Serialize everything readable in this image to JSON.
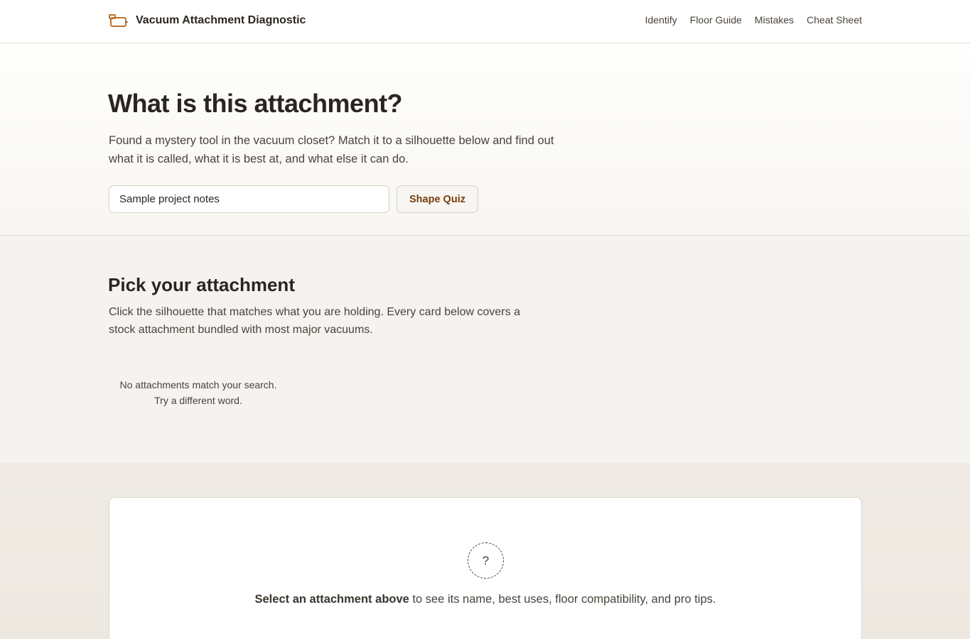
{
  "header": {
    "brand_icon": "vacuum-attachment-icon",
    "title": "Vacuum Attachment Diagnostic",
    "nav": [
      "Identify",
      "Floor Guide",
      "Mistakes",
      "Cheat Sheet"
    ]
  },
  "hero": {
    "heading": "What is this attachment?",
    "description": "Found a mystery tool in the vacuum closet? Match it to a silhouette below and find out what it is called, what it is best at, and what else it can do.",
    "search_value": "Sample project notes",
    "quiz_button": "Shape Quiz"
  },
  "pick": {
    "heading": "Pick your attachment",
    "description": "Click the silhouette that matches what you are holding. Every card below covers a stock attachment bundled with most major vacuums.",
    "empty_line1": "No attachments match your search.",
    "empty_line2": "Try a different word."
  },
  "details": {
    "icon": "question-mark-icon",
    "icon_text": "?",
    "prompt_bold": "Select an attachment above",
    "prompt_rest": " to see its name, best uses, floor compatibility, and pro tips."
  },
  "colors": {
    "accent": "#b8752a",
    "button_text": "#7a3d0c",
    "text": "#2a2520",
    "muted": "#4a433b"
  }
}
